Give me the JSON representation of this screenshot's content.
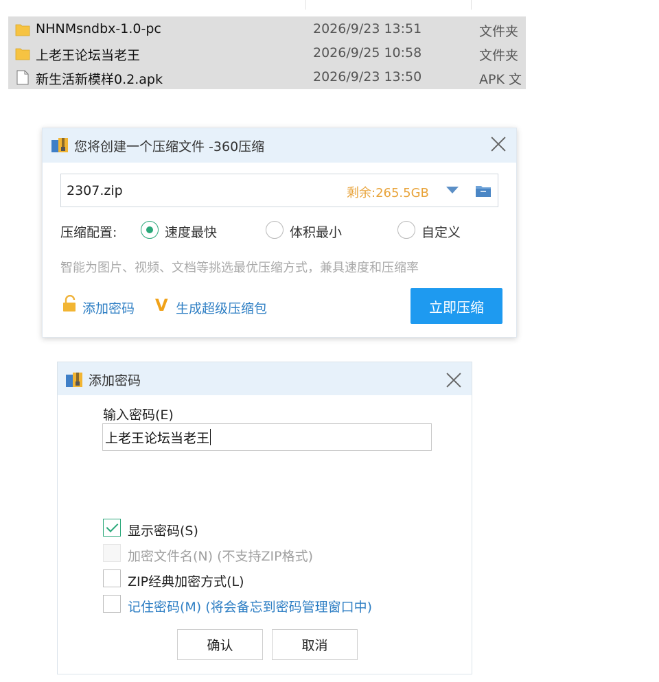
{
  "file_list": {
    "rows": [
      {
        "icon": "folder-icon",
        "name": "NHNMsndbx-1.0-pc",
        "date": "2026/9/23 13:51",
        "type": "文件夹"
      },
      {
        "icon": "folder-icon",
        "name": "上老王论坛当老王",
        "date": "2026/9/25 10:58",
        "type": "文件夹"
      },
      {
        "icon": "file-icon",
        "name": "新生活新模样0.2.apk",
        "date": "2026/9/23 13:50",
        "type": "APK 文"
      }
    ]
  },
  "compress_dialog": {
    "title": "您将创建一个压缩文件 -360压缩",
    "icon": "archive-app-icon",
    "file_path": "2307.zip",
    "free_space": "剩余:265.5GB",
    "config_label": "压缩配置:",
    "options": [
      {
        "label": "速度最快",
        "selected": true
      },
      {
        "label": "体积最小",
        "selected": false
      },
      {
        "label": "自定义",
        "selected": false
      }
    ],
    "hint": "智能为图片、视频、文档等挑选最优压缩方式，兼具速度和压缩率",
    "add_password": "添加密码",
    "super_pack": "生成超级压缩包",
    "compress_now": "立即压缩",
    "colors": {
      "primary": "#1e9af0",
      "link": "#2f7fc4",
      "free_space": "#e8a33a",
      "title_bar": "#e7f1fa"
    }
  },
  "password_dialog": {
    "title": "添加密码",
    "icon": "archive-app-icon",
    "input_label": "输入密码(E)",
    "input_value": "上老王论坛当老王",
    "checkboxes": [
      {
        "label": "显示密码(S)",
        "checked": true,
        "disabled": false
      },
      {
        "label": "加密文件名(N) (不支持ZIP格式)",
        "checked": false,
        "disabled": true
      },
      {
        "label": "ZIP经典加密方式(L)",
        "checked": false,
        "disabled": false
      },
      {
        "label": "记住密码(M) (将会备忘到密码管理窗口中)",
        "checked": false,
        "disabled": false
      }
    ],
    "ok": "确认",
    "cancel": "取消"
  }
}
